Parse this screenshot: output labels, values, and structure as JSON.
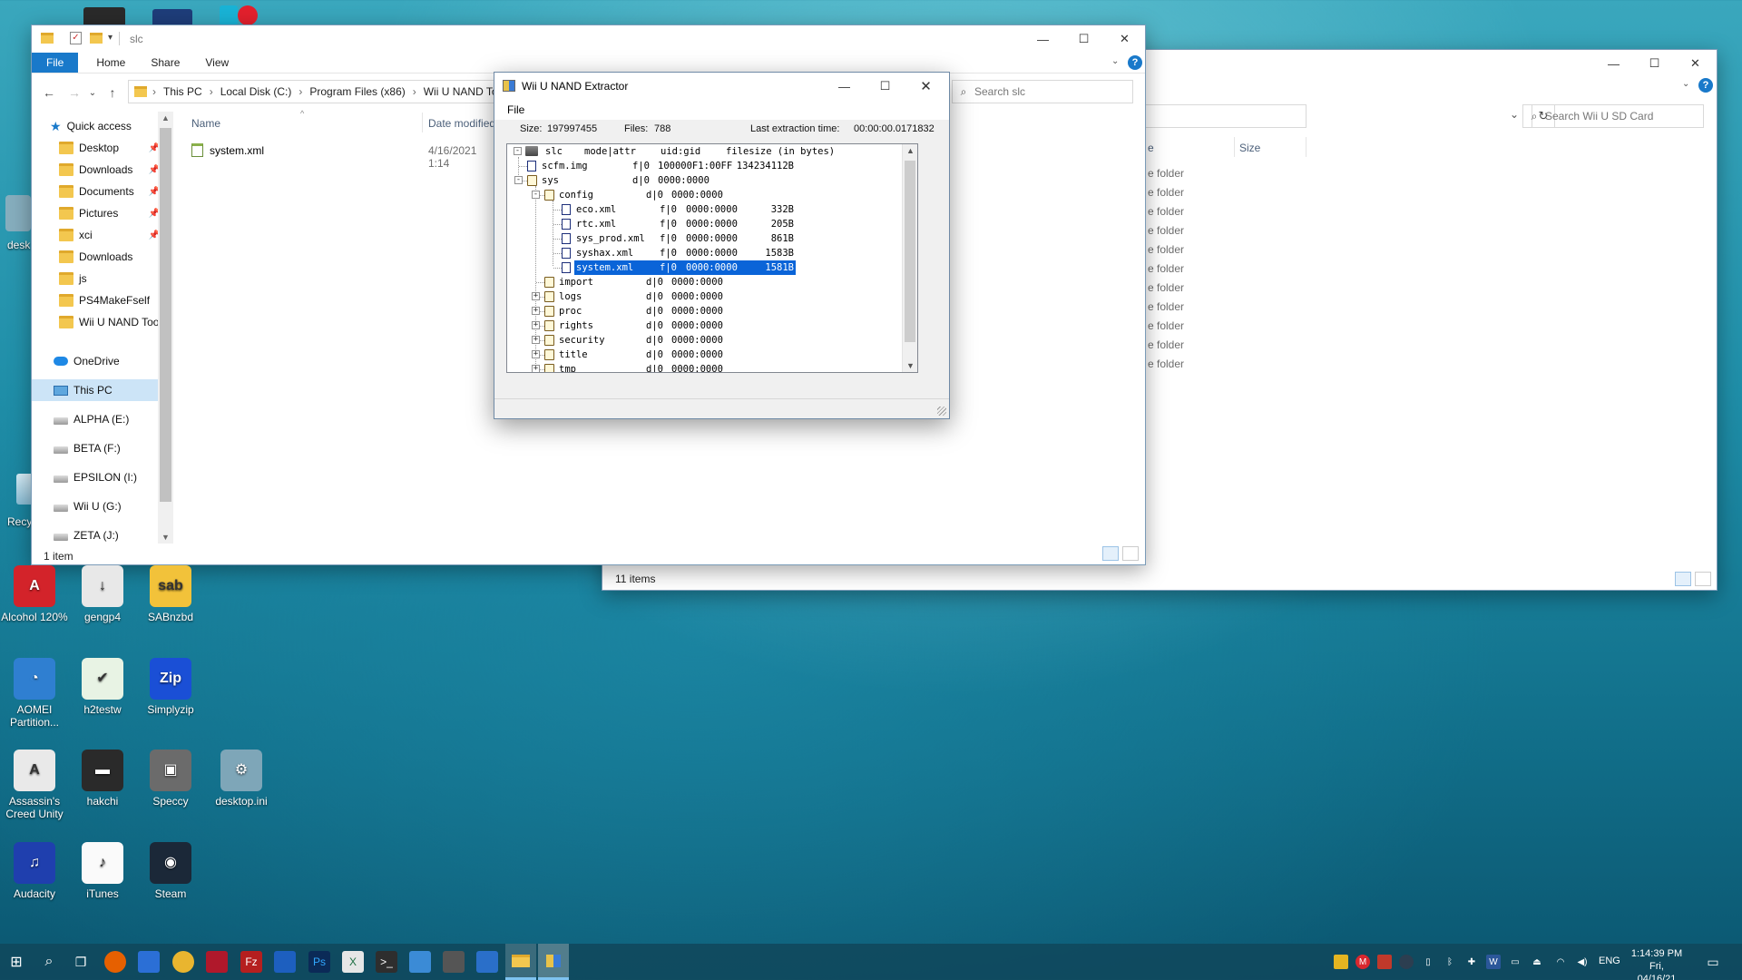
{
  "explorer_left": {
    "title": "slc",
    "ribbon_tabs": [
      "File",
      "Home",
      "Share",
      "View"
    ],
    "breadcrumb": [
      "This PC",
      "Local Disk (C:)",
      "Program Files (x86)",
      "Wii U NAND To"
    ],
    "search_placeholder": "Search slc",
    "quick_access_label": "Quick access",
    "nav_items": [
      {
        "label": "Desktop",
        "pinned": true
      },
      {
        "label": "Downloads",
        "pinned": true
      },
      {
        "label": "Documents",
        "pinned": true
      },
      {
        "label": "Pictures",
        "pinned": true
      },
      {
        "label": "xci",
        "pinned": true
      },
      {
        "label": "Downloads",
        "pinned": false
      },
      {
        "label": "js",
        "pinned": false
      },
      {
        "label": "PS4MakeFself",
        "pinned": false
      },
      {
        "label": "Wii U NAND Too",
        "pinned": false
      }
    ],
    "onedrive_label": "OneDrive",
    "this_pc_label": "This PC",
    "drives": [
      "ALPHA (E:)",
      "BETA (F:)",
      "EPSILON (I:)",
      "Wii U (G:)",
      "ZETA (J:)"
    ],
    "columns": {
      "name": "Name",
      "date": "Date modified"
    },
    "files": [
      {
        "name": "system.xml",
        "date": "4/16/2021 1:14"
      }
    ],
    "status": "1 item"
  },
  "explorer_right": {
    "search_placeholder": "Search Wii U SD Card",
    "columns": {
      "type_partial": "e",
      "size": "Size"
    },
    "rows": [
      "e folder",
      "e folder",
      "e folder",
      "e folder",
      "e folder",
      "e folder",
      "e folder",
      "e folder",
      "e folder",
      "e folder",
      "e folder"
    ],
    "status": "11 items"
  },
  "nand_extractor": {
    "title": "Wii U NAND Extractor",
    "menu": "File",
    "size_label": "Size:",
    "size_value": "197997455",
    "files_label": "Files:",
    "files_value": "788",
    "extraction_label": "Last extraction time:",
    "extraction_value": "00:00:00.0171832",
    "header": {
      "name": "slc",
      "mode": "mode|attr",
      "uid": "uid:gid",
      "size": "filesize (in bytes)"
    },
    "rows": [
      {
        "name": "scfm.img",
        "mode": "f|0",
        "uid": "100000F1:00FF",
        "size": "134234112B",
        "kind": "file",
        "depth": 1
      },
      {
        "name": "sys",
        "mode": "d|0",
        "uid": "0000:0000",
        "size": "",
        "kind": "folder",
        "depth": 1,
        "toggle": "-"
      },
      {
        "name": "config",
        "mode": "d|0",
        "uid": "0000:0000",
        "size": "",
        "kind": "folder",
        "depth": 2,
        "toggle": "-"
      },
      {
        "name": "eco.xml",
        "mode": "f|0",
        "uid": "0000:0000",
        "size": "332B",
        "kind": "file",
        "depth": 3
      },
      {
        "name": "rtc.xml",
        "mode": "f|0",
        "uid": "0000:0000",
        "size": "205B",
        "kind": "file",
        "depth": 3
      },
      {
        "name": "sys_prod.xml",
        "mode": "f|0",
        "uid": "0000:0000",
        "size": "861B",
        "kind": "file",
        "depth": 3
      },
      {
        "name": "syshax.xml",
        "mode": "f|0",
        "uid": "0000:0000",
        "size": "1583B",
        "kind": "file",
        "depth": 3
      },
      {
        "name": "system.xml",
        "mode": "f|0",
        "uid": "0000:0000",
        "size": "1581B",
        "kind": "file",
        "depth": 3,
        "selected": true
      },
      {
        "name": "import",
        "mode": "d|0",
        "uid": "0000:0000",
        "size": "",
        "kind": "folder",
        "depth": 2
      },
      {
        "name": "logs",
        "mode": "d|0",
        "uid": "0000:0000",
        "size": "",
        "kind": "folder",
        "depth": 2,
        "toggle": "+"
      },
      {
        "name": "proc",
        "mode": "d|0",
        "uid": "0000:0000",
        "size": "",
        "kind": "folder",
        "depth": 2,
        "toggle": "+"
      },
      {
        "name": "rights",
        "mode": "d|0",
        "uid": "0000:0000",
        "size": "",
        "kind": "folder",
        "depth": 2,
        "toggle": "+"
      },
      {
        "name": "security",
        "mode": "d|0",
        "uid": "0000:0000",
        "size": "",
        "kind": "folder",
        "depth": 2,
        "toggle": "+"
      },
      {
        "name": "title",
        "mode": "d|0",
        "uid": "0000:0000",
        "size": "",
        "kind": "folder",
        "depth": 2,
        "toggle": "+"
      },
      {
        "name": "tmp",
        "mode": "d|0",
        "uid": "0000:0000",
        "size": "",
        "kind": "folder",
        "depth": 2,
        "toggle": "+"
      }
    ]
  },
  "desktop_icons": [
    {
      "label": "Alcohol 120%",
      "icon": "alcohol-icon",
      "color": "#d3232a",
      "glyph": "A"
    },
    {
      "label": "gengp4",
      "icon": "download-icon",
      "color": "#e8e8e8",
      "glyph": "↓"
    },
    {
      "label": "SABnzbd",
      "icon": "sabnzbd-icon",
      "color": "#f2c23a",
      "glyph": "sab"
    },
    {
      "label": "AOMEI Partition...",
      "icon": "aomei-icon",
      "color": "#2f7fd1",
      "glyph": "◔"
    },
    {
      "label": "h2testw",
      "icon": "checkmark-icon",
      "color": "#e8f3e4",
      "glyph": "✔"
    },
    {
      "label": "Simplyzip",
      "icon": "zip-icon",
      "color": "#1a4fd6",
      "glyph": "Zip"
    },
    {
      "label": "Assassin's Creed Unity",
      "icon": "assassins-creed-icon",
      "color": "#e9e9e9",
      "glyph": "A"
    },
    {
      "label": "hakchi",
      "icon": "hakchi-icon",
      "color": "#2a2a2a",
      "glyph": "▬"
    },
    {
      "label": "Speccy",
      "icon": "speccy-icon",
      "color": "#6b6b6b",
      "glyph": "▣"
    },
    {
      "label": "desktop.ini",
      "icon": "settings-file-icon",
      "color": "#7ea6b8",
      "glyph": "⚙"
    },
    {
      "label": "Audacity",
      "icon": "audacity-icon",
      "color": "#1f3fae",
      "glyph": "♫"
    },
    {
      "label": "iTunes",
      "icon": "itunes-icon",
      "color": "#fafafa",
      "glyph": "♪"
    },
    {
      "label": "Steam",
      "icon": "steam-icon",
      "color": "#1b2838",
      "glyph": "◉"
    }
  ],
  "taskbar": {
    "language": "ENG",
    "time": "1:14:39 PM",
    "date": "Fri, 04/16/21"
  }
}
